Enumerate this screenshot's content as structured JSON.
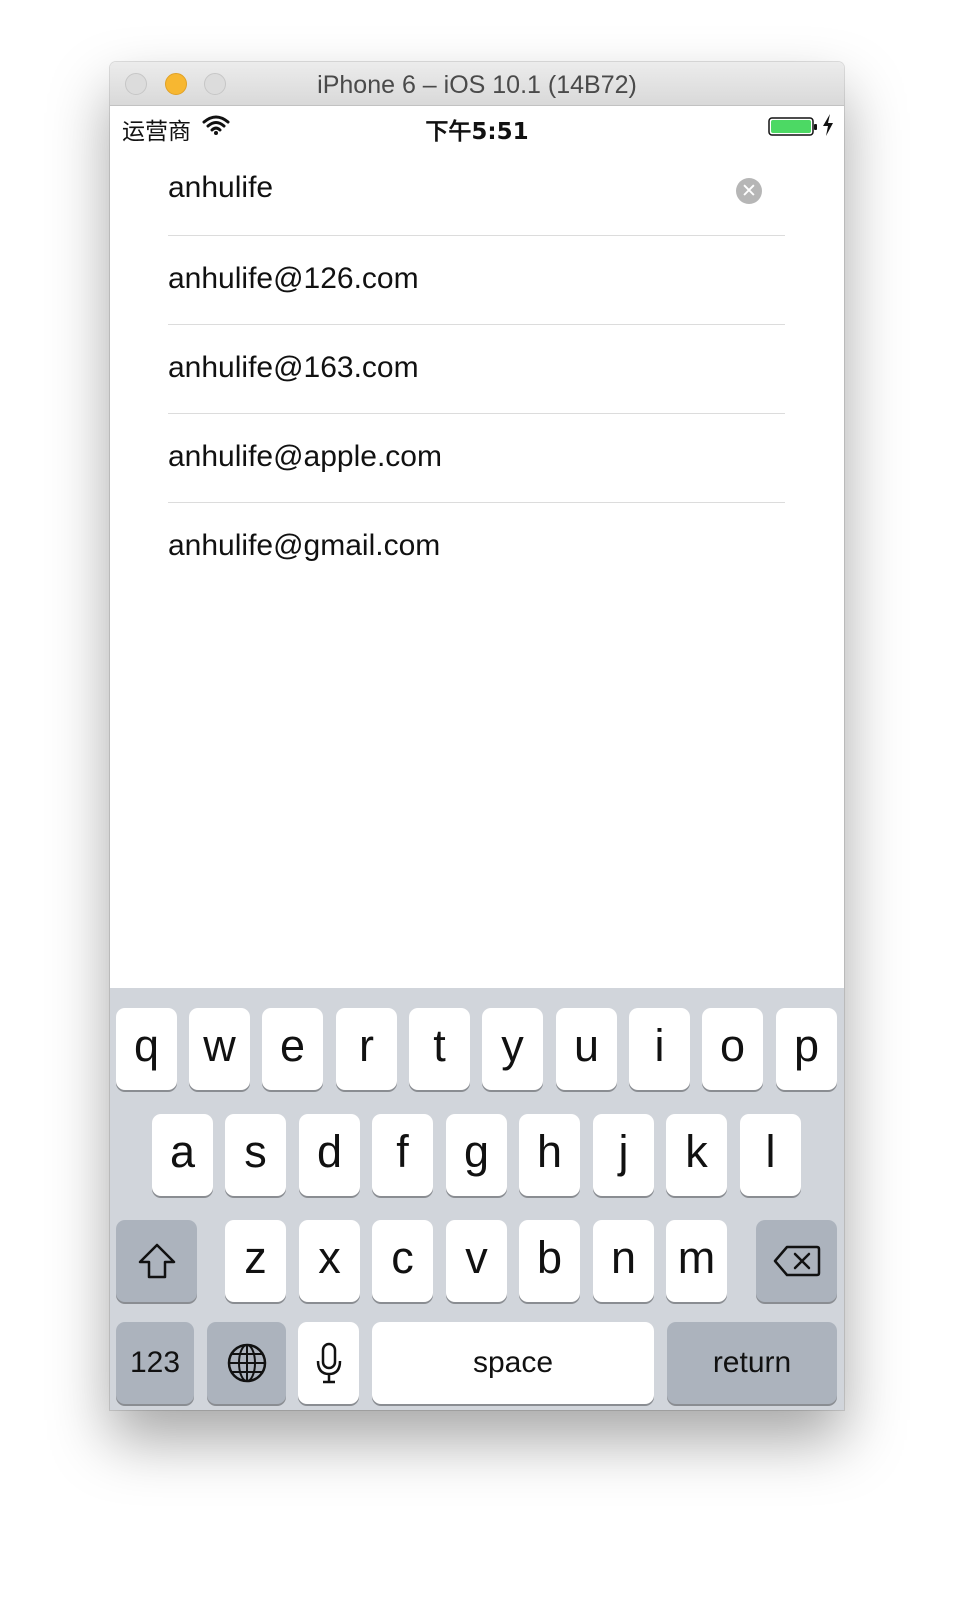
{
  "window": {
    "title": "iPhone 6 – iOS 10.1 (14B72)"
  },
  "status_bar": {
    "carrier": "运营商",
    "time": "下午5:51",
    "battery_color": "#4cd964"
  },
  "search": {
    "value": "anhulife",
    "clear_glyph": "✕"
  },
  "suggestions": [
    "anhulife@126.com",
    "anhulife@163.com",
    "anhulife@apple.com",
    "anhulife@gmail.com"
  ],
  "keyboard": {
    "row1": [
      "q",
      "w",
      "e",
      "r",
      "t",
      "y",
      "u",
      "i",
      "o",
      "p"
    ],
    "row2": [
      "a",
      "s",
      "d",
      "f",
      "g",
      "h",
      "j",
      "k",
      "l"
    ],
    "row3": [
      "z",
      "x",
      "c",
      "v",
      "b",
      "n",
      "m"
    ],
    "numbers_label": "123",
    "space_label": "space",
    "return_label": "return",
    "icons": [
      "shift-icon",
      "delete-icon",
      "globe-icon",
      "microphone-icon"
    ]
  },
  "colors": {
    "keyboard_bg": "#d1d5db",
    "dark_key": "#acb3bd",
    "minimize_button": "#f7b731"
  }
}
